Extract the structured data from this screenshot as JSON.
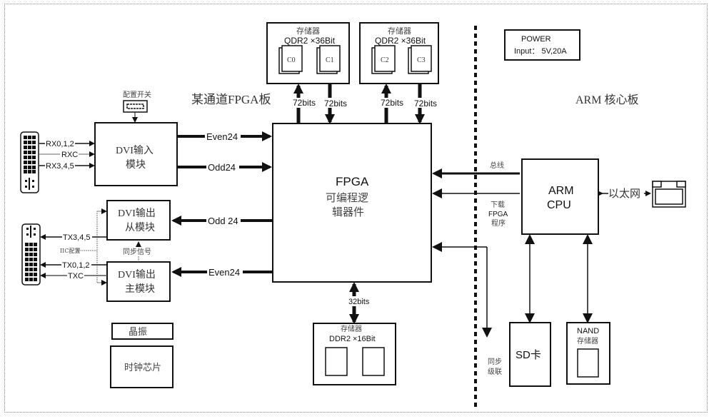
{
  "board_titles": {
    "fpga_board": "某通道FPGA板",
    "arm_board": "ARM 核心板"
  },
  "power": {
    "line1": "POWER",
    "line2": "Input：  5V,20A"
  },
  "config_switch": {
    "label": "配置开关"
  },
  "dvi_in": {
    "line1": "DVI输入",
    "line2": "模块",
    "signals": [
      "RX0,1,2",
      "RXC",
      "RX3,4,5"
    ],
    "out_even": "Even24",
    "out_odd": "Odd24"
  },
  "dvi_out_slave": {
    "line1": "DVI输出",
    "line2": "从模块",
    "in_label": "Odd 24",
    "signal": "TX3,4,5"
  },
  "dvi_out_master": {
    "line1": "DVI输出",
    "line2": "主模块",
    "in_label": "Even24",
    "signals": [
      "TX0,1,2",
      "TXC"
    ]
  },
  "iic_label": "IIC配置",
  "sync_signal_label": "同步信号",
  "crystal": "晶振",
  "clock_chip": "时钟芯片",
  "fpga": {
    "line1": "FPGA",
    "line2": "可编程逻",
    "line3": "辑器件"
  },
  "qdr_left": {
    "title": "存储器",
    "type": "QDR2 ×36Bit",
    "chips": [
      "C0",
      "C1"
    ],
    "bus_up": "72bits",
    "bus_down": "72bits"
  },
  "qdr_right": {
    "title": "存储器",
    "type": "QDR2 ×36Bit",
    "chips": [
      "C2",
      "C3"
    ],
    "bus_up": "72bits",
    "bus_down": "72bits"
  },
  "ddr": {
    "title": "存储器",
    "type": "DDR2 ×16Bit",
    "bus": "32bits"
  },
  "arm": {
    "line1": "ARM",
    "line2": "CPU"
  },
  "bus_label": "总线",
  "download_label": {
    "line1": "下载",
    "line2": "FPGA",
    "line3": "程序"
  },
  "sync_cascade": {
    "line1": "同步",
    "line2": "级联"
  },
  "ethernet_label": "以太网",
  "sd_card": "SD卡",
  "nand": {
    "line1": "NAND",
    "line2": "存储器"
  }
}
